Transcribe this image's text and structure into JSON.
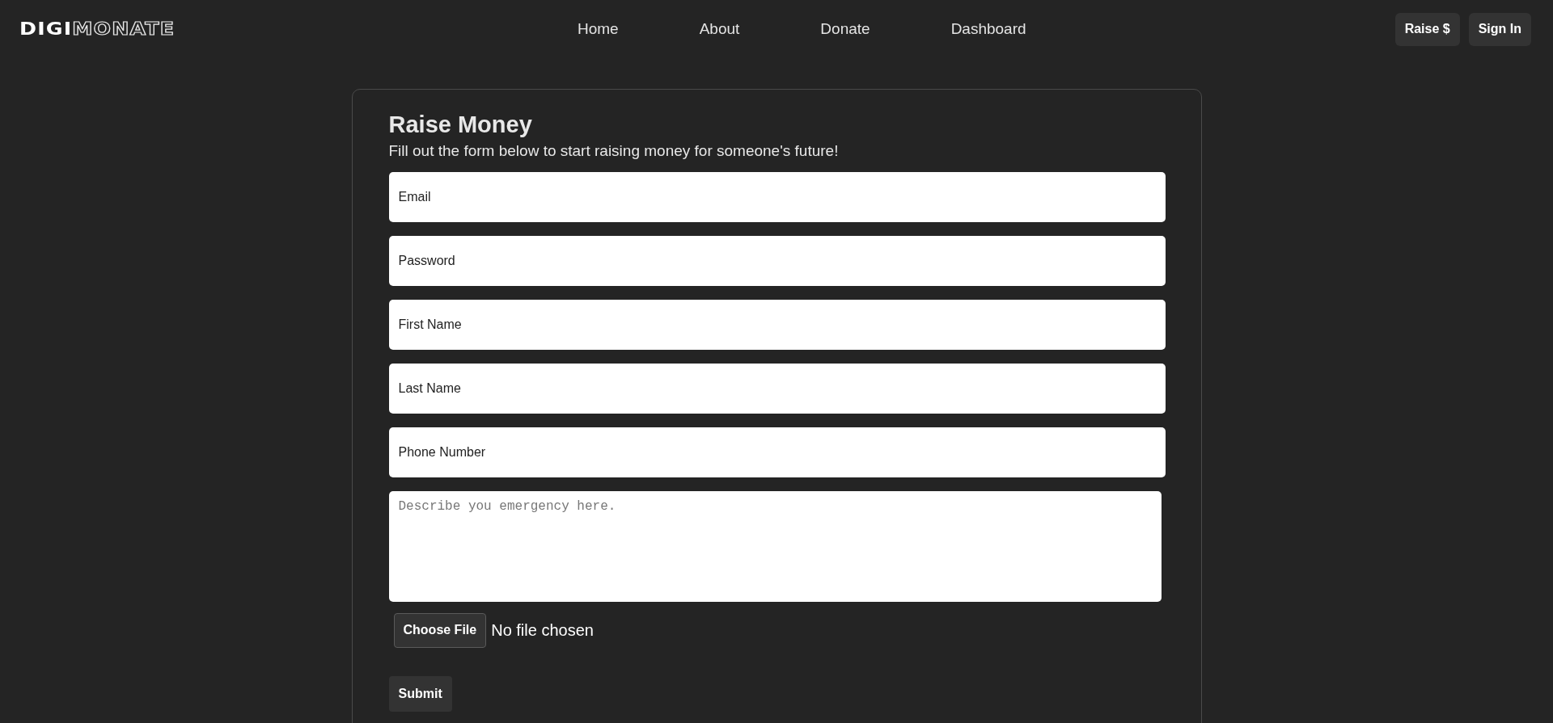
{
  "logo": {
    "filled": "DIGI",
    "outlined": "MONATE"
  },
  "nav": [
    "Home",
    "About",
    "Donate",
    "Dashboard"
  ],
  "actions": [
    "Raise $",
    "Sign In"
  ],
  "form": {
    "title": "Raise Money",
    "subtitle": "Fill out the form below to start raising money for someone's future!",
    "fields": [
      {
        "placeholder": "Email"
      },
      {
        "placeholder": "Password"
      },
      {
        "placeholder": "First Name"
      },
      {
        "placeholder": "Last Name"
      },
      {
        "placeholder": "Phone Number"
      }
    ],
    "description": {
      "placeholder": "Describe you emergency here."
    },
    "file": {
      "button": "Choose File",
      "status": "No file chosen"
    },
    "submit": "Submit"
  }
}
